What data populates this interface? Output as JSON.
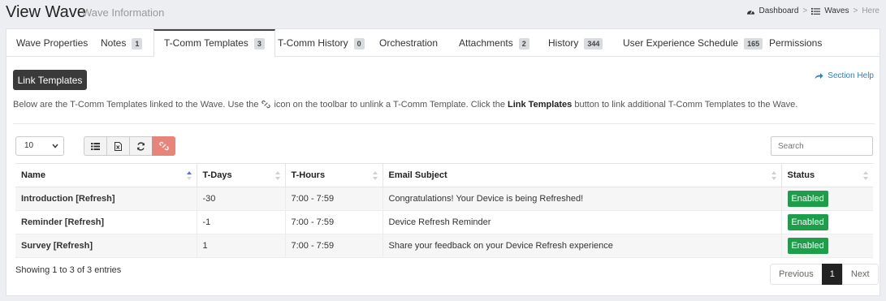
{
  "header": {
    "title": "View Wave",
    "subtitle": "Wave Information",
    "breadcrumb": {
      "dashboard": "Dashboard",
      "sep1": ">",
      "waves": "Waves",
      "sep2": ">",
      "current": "Here"
    }
  },
  "tabs": [
    {
      "label": "Wave Properties",
      "badge": ""
    },
    {
      "label": "Notes",
      "badge": "1"
    },
    {
      "label": "T-Comm Templates",
      "badge": "3"
    },
    {
      "label": "T-Comm History",
      "badge": "0"
    },
    {
      "label": "Orchestration",
      "badge": ""
    },
    {
      "label": "Attachments",
      "badge": "2"
    },
    {
      "label": "History",
      "badge": "344"
    },
    {
      "label": "User Experience Schedule",
      "badge": "165"
    },
    {
      "label": "Permissions",
      "badge": ""
    }
  ],
  "active_tab": "T-Comm Templates",
  "actions": {
    "link_templates": "Link Templates",
    "section_help": "Section Help"
  },
  "description": {
    "part1": "Below are the T-Comm Templates linked to the Wave. Use the",
    "part2": "icon on the toolbar to unlink a T-Comm Template. Click the",
    "bold": "Link Templates",
    "part3": "button to link additional T-Comm Templates to the Wave."
  },
  "controls": {
    "page_size": "10",
    "search_placeholder": "Search"
  },
  "table": {
    "columns": [
      "Name",
      "T-Days",
      "T-Hours",
      "Email Subject",
      "Status"
    ],
    "rows": [
      {
        "name": "Introduction [Refresh]",
        "tdays": "-30",
        "thours": "7:00 - 7:59",
        "subject": "Congratulations! Your Device is being Refreshed!",
        "status": "Enabled"
      },
      {
        "name": "Reminder [Refresh]",
        "tdays": "-1",
        "thours": "7:00 - 7:59",
        "subject": "Device Refresh Reminder",
        "status": "Enabled"
      },
      {
        "name": "Survey [Refresh]",
        "tdays": "1",
        "thours": "7:00 - 7:59",
        "subject": "Share your feedback on your Device Refresh experience",
        "status": "Enabled"
      }
    ]
  },
  "footer": {
    "info": "Showing 1 to 3 of 3 entries",
    "previous": "Previous",
    "current_page": "1",
    "next": "Next"
  },
  "colors": {
    "enabled_green": "#1e9e4a",
    "unlink_button": "#e8857a",
    "link_blue": "#2f7fbd",
    "dark_button": "#3a3a3a"
  }
}
